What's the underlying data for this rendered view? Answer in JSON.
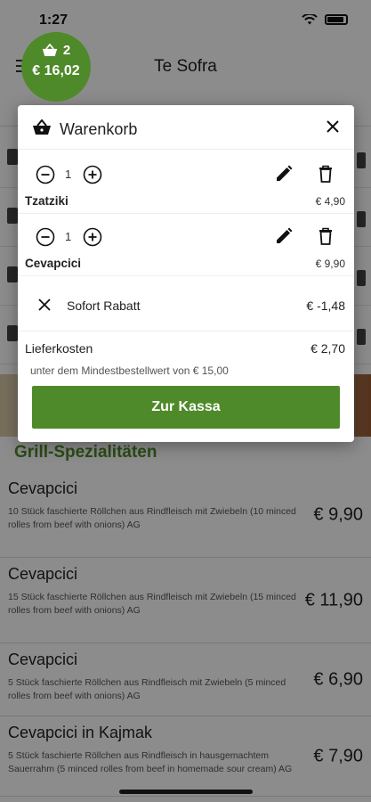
{
  "status_bar": {
    "time": "1:27"
  },
  "app_bar": {
    "title": "Te Sofra"
  },
  "cart_badge": {
    "count": "2",
    "total": "€ 16,02"
  },
  "section": {
    "title": "Grill-Spezialitäten"
  },
  "menu_items": [
    {
      "name": "Cevapcici",
      "description": "10 Stück faschierte Röllchen aus Rindfleisch mit Zwiebeln (10 minced rolles from beef with onions) AG",
      "price": "€ 9,90"
    },
    {
      "name": "Cevapcici",
      "description": "15 Stück faschierte Röllchen aus Rindfleisch mit Zwiebeln (15 minced rolles from beef with onions) AG",
      "price": "€ 11,90"
    },
    {
      "name": "Cevapcici",
      "description": "5 Stück faschierte Röllchen aus Rindfleisch mit Zwiebeln (5 minced rolles from beef with onions) AG",
      "price": "€ 6,90"
    },
    {
      "name": "Cevapcici in Kajmak",
      "description": "5 Stück faschierte Röllchen aus Rindfleisch in hausgemachtem Sauerrahm (5 minced rolles from beef in homemade sour cream) AG",
      "price": "€ 7,90"
    }
  ],
  "cart": {
    "title": "Warenkorb",
    "items": [
      {
        "name": "Tzatziki",
        "quantity": "1",
        "price": "€ 4,90"
      },
      {
        "name": "Cevapcici",
        "quantity": "1",
        "price": "€ 9,90"
      }
    ],
    "discount": {
      "label": "Sofort Rabatt",
      "value": "€ -1,48"
    },
    "delivery": {
      "label": "Lieferkosten",
      "value": "€ 2,70"
    },
    "min_order_note": "unter dem Mindestbestellwert von € 15,00",
    "checkout_label": "Zur Kassa"
  },
  "colors": {
    "accent": "#4f8a2a",
    "overlay": "rgba(0,0,0,0.45)"
  },
  "icons": [
    "basket-icon",
    "close-icon",
    "minus-circle-icon",
    "plus-circle-icon",
    "pencil-icon",
    "trash-icon",
    "menu-icon",
    "wifi-icon",
    "battery-icon"
  ]
}
